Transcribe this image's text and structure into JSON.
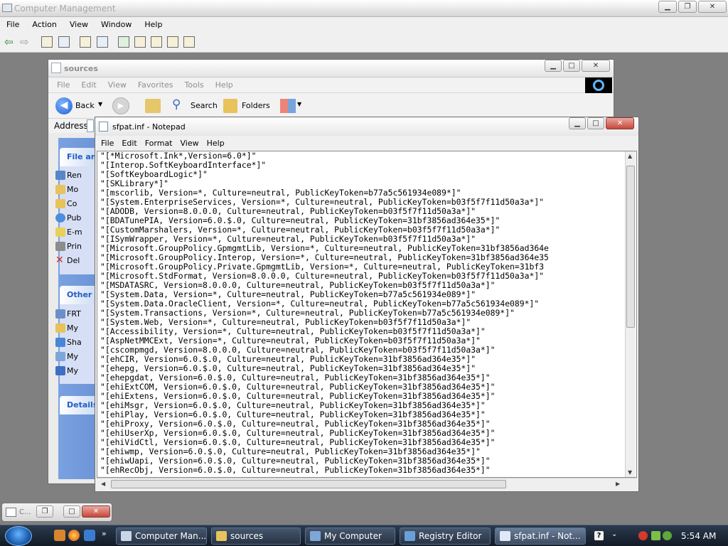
{
  "computer_management": {
    "title": "Computer Management",
    "menu": [
      "File",
      "Action",
      "View",
      "Window",
      "Help"
    ]
  },
  "explorer": {
    "title": "sources",
    "menu": [
      "File",
      "Edit",
      "View",
      "Favorites",
      "Tools",
      "Help"
    ],
    "toolbar": {
      "back": "Back",
      "search": "Search",
      "folders": "Folders"
    },
    "address_label": "Address",
    "tasks_header": "File and",
    "tasks": [
      "Ren",
      "Mo",
      "Co",
      "Pub",
      "E-m",
      "Prin",
      "Del"
    ],
    "other_header": "Other",
    "other": [
      "FRT",
      "My",
      "Sha",
      "My",
      "My"
    ],
    "details_header": "Details"
  },
  "notepad": {
    "title": "sfpat.inf - Notepad",
    "menu": [
      "File",
      "Edit",
      "Format",
      "View",
      "Help"
    ],
    "lines": [
      "\"[*Microsoft.Ink*,Version=6.0*]\"",
      "\"[Interop.SoftKeyboardInterface*]\"",
      "\"[SoftKeyboardLogic*]\"",
      "\"[SKLibrary*]\"",
      "\"[mscorlib, Version=*, Culture=neutral, PublicKeyToken=b77a5c561934e089*]\"",
      "\"[System.EnterpriseServices, Version=*, Culture=neutral, PublicKeyToken=b03f5f7f11d50a3a*]\"",
      "\"[ADODB, Version=8.0.0.0, Culture=neutral, PublicKeyToken=b03f5f7f11d50a3a*]\"",
      "\"[BDATunePIA, Version=6.0.$.0, Culture=neutral, PublicKeyToken=31bf3856ad364e35*]\"",
      "\"[CustomMarshalers, Version=*, Culture=neutral, PublicKeyToken=b03f5f7f11d50a3a*]\"",
      "\"[ISymWrapper, Version=*, Culture=neutral, PublicKeyToken=b03f5f7f11d50a3a*]\"",
      "\"[Microsoft.GroupPolicy.GpmgmtLib, Version=*, Culture=neutral, PublicKeyToken=31bf3856ad364e",
      "\"[Microsoft.GroupPolicy.Interop, Version=*, Culture=neutral, PublicKeyToken=31bf3856ad364e35",
      "\"[Microsoft.GroupPolicy.Private.GpmgmtLib, Version=*, Culture=neutral, PublicKeyToken=31bf3",
      "\"[Microsoft.StdFormat, Version=8.0.0.0, Culture=neutral, PublicKeyToken=b03f5f7f11d50a3a*]\"",
      "\"[MSDATASRC, Version=8.0.0.0, Culture=neutral, PublicKeyToken=b03f5f7f11d50a3a*]\"",
      "\"[System.Data, Version=*, Culture=neutral, PublicKeyToken=b77a5c561934e089*]\"",
      "\"[System.Data.OracleClient, Version=*, Culture=neutral, PublicKeyToken=b77a5c561934e089*]\"",
      "\"[System.Transactions, Version=*, Culture=neutral, PublicKeyToken=b77a5c561934e089*]\"",
      "\"[System.Web, Version=*, Culture=neutral, PublicKeyToken=b03f5f7f11d50a3a*]\"",
      "\"[Accessibility, Version=*, Culture=neutral, PublicKeyToken=b03f5f7f11d50a3a*]\"",
      "\"[AspNetMMCExt, Version=*, Culture=neutral, PublicKeyToken=b03f5f7f11d50a3a*]\"",
      "\"[cscompmgd, Version=8.0.0.0, Culture=neutral, PublicKeyToken=b03f5f7f11d50a3a*]\"",
      "\"[ehCIR, Version=6.0.$.0, Culture=neutral, PublicKeyToken=31bf3856ad364e35*]\"",
      "\"[ehepg, Version=6.0.$.0, Culture=neutral, PublicKeyToken=31bf3856ad364e35*]\"",
      "\"[ehepgdat, Version=6.0.$.0, Culture=neutral, PublicKeyToken=31bf3856ad364e35*]\"",
      "\"[ehiExtCOM, Version=6.0.$.0, Culture=neutral, PublicKeyToken=31bf3856ad364e35*]\"",
      "\"[ehiExtens, Version=6.0.$.0, Culture=neutral, PublicKeyToken=31bf3856ad364e35*]\"",
      "\"[ehiMsgr, Version=6.0.$.0, Culture=neutral, PublicKeyToken=31bf3856ad364e35*]\"",
      "\"[ehiPlay, Version=6.0.$.0, Culture=neutral, PublicKeyToken=31bf3856ad364e35*]\"",
      "\"[ehiProxy, Version=6.0.$.0, Culture=neutral, PublicKeyToken=31bf3856ad364e35*]\"",
      "\"[ehiUserXp, Version=6.0.$.0, Culture=neutral, PublicKeyToken=31bf3856ad364e35*]\"",
      "\"[ehiVidCtl, Version=6.0.$.0, Culture=neutral, PublicKeyToken=31bf3856ad364e35*]\"",
      "\"[ehiwmp, Version=6.0.$.0, Culture=neutral, PublicKeyToken=31bf3856ad364e35*]\"",
      "\"[ehiwUapi, Version=6.0.$.0, Culture=neutral, PublicKeyToken=31bf3856ad364e35*]\"",
      "\"[ehRecObj, Version=6.0.$.0, Culture=neutral, PublicKeyToken=31bf3856ad364e35*]\""
    ]
  },
  "minimized": {
    "title": "C..."
  },
  "taskbar": {
    "tasks": [
      {
        "label": "Computer Man...",
        "icon": "computer-management-icon",
        "color": "#c9d6e8"
      },
      {
        "label": "sources",
        "icon": "folder-icon",
        "color": "#e8c25a"
      },
      {
        "label": "My Computer",
        "icon": "my-computer-icon",
        "color": "#7fa6d8"
      },
      {
        "label": "Registry Editor",
        "icon": "registry-editor-icon",
        "color": "#6aa0d8"
      },
      {
        "label": "sfpat.inf - Not...",
        "icon": "notepad-icon",
        "color": "#dfe9f5"
      }
    ],
    "clock": "5:54 AM"
  },
  "colors": {
    "accent": "#215dc6",
    "taskbar": "#1b2532",
    "desktop": "#808080"
  }
}
